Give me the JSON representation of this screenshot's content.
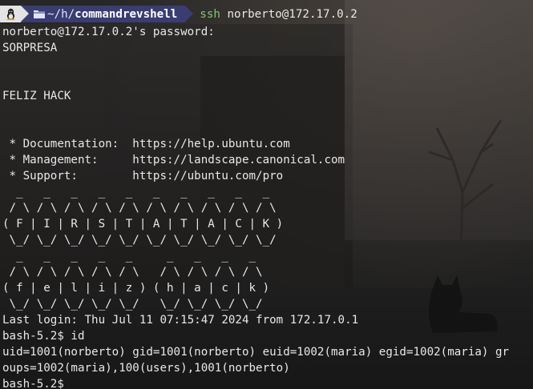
{
  "prompt": {
    "os_icon": "linux-tux-icon",
    "folder_icon": "folder-icon",
    "path_prefix": "~/h/",
    "path_dir": "commandrevshell",
    "command": "ssh",
    "command_args": "norberto@172.17.0.2"
  },
  "output_lines": [
    "norberto@172.17.0.2's password: ",
    "SORPRESA",
    "",
    "",
    "FELIZ HACK",
    "",
    "",
    " * Documentation:  https://help.ubuntu.com",
    " * Management:     https://landscape.canonical.com",
    " * Support:        https://ubuntu.com/pro",
    "  _   _   _   _   _   _   _   _   _   _",
    " / \\ / \\ / \\ / \\ / \\ / \\ / \\ / \\ / \\ / \\",
    "( F | I | R | S | T | A | T | A | C | K )",
    " \\_/ \\_/ \\_/ \\_/ \\_/ \\_/ \\_/ \\_/ \\_/ \\_/",
    "  _   _   _   _   _     _   _   _   _",
    " / \\ / \\ / \\ / \\ / \\   / \\ / \\ / \\ / \\",
    "( f | e | l | i | z ) ( h | a | c | k )",
    " \\_/ \\_/ \\_/ \\_/ \\_/   \\_/ \\_/ \\_/ \\_/",
    "Last login: Thu Jul 11 07:15:47 2024 from 172.17.0.1",
    "bash-5.2$ id",
    "uid=1001(norberto) gid=1001(norberto) euid=1002(maria) egid=1002(maria) gr",
    "oups=1002(maria),100(users),1001(norberto)",
    "bash-5.2$ "
  ]
}
